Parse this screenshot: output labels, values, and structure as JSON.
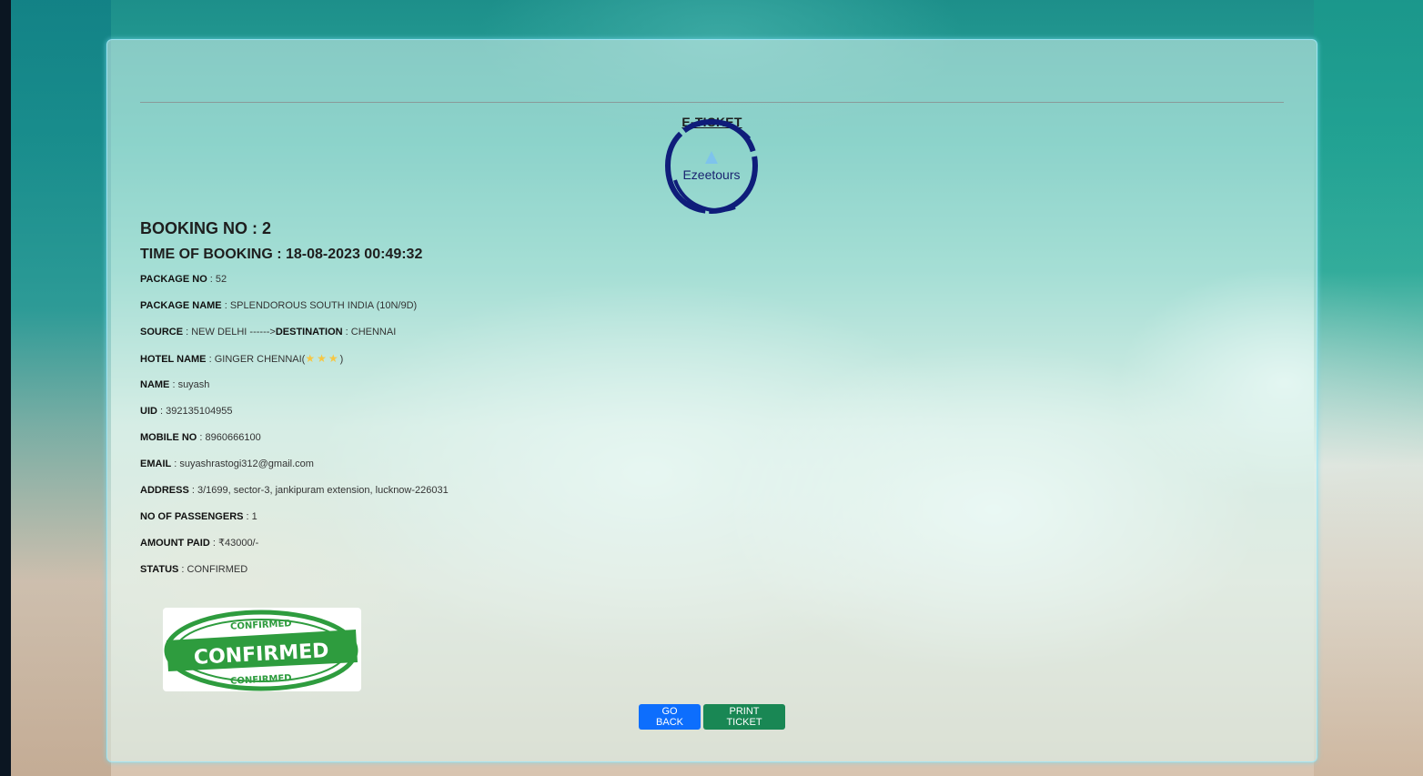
{
  "page": {
    "title": "E-TICKET"
  },
  "logo": {
    "text": "Ezeetours"
  },
  "booking": {
    "booking_no_label": "BOOKING NO :",
    "booking_no": "2",
    "time_label": "TIME OF BOOKING :",
    "time": "18-08-2023 00:49:32"
  },
  "details": {
    "package_no_label": "PACKAGE NO",
    "package_no": "52",
    "package_name_label": "PACKAGE NAME",
    "package_name": "SPLENDOROUS SOUTH INDIA (10N/9D)",
    "source_label": "SOURCE",
    "source": "NEW DELHI",
    "arrow": "------>",
    "destination_label": "DESTINATION",
    "destination": "CHENNAI",
    "hotel_label": "HOTEL NAME",
    "hotel_name": "GINGER CHENNAI",
    "hotel_stars": "★★★",
    "name_label": "NAME",
    "name": "suyash",
    "uid_label": "UID",
    "uid": "392135104955",
    "mobile_label": "MOBILE NO",
    "mobile": "8960666100",
    "email_label": "EMAIL",
    "email": "suyashrastogi312@gmail.com",
    "address_label": "ADDRESS",
    "address": "3/1699, sector-3, jankipuram extension, lucknow-226031",
    "passengers_label": "NO OF PASSENGERS",
    "passengers": "1",
    "amount_label": "AMOUNT PAID",
    "amount": "₹43000/-",
    "status_label": "STATUS",
    "status": "CONFIRMED"
  },
  "stamp": {
    "text": "CONFIRMED",
    "ring_text": "CONFIRMED"
  },
  "actions": {
    "back_label": "GO BACK",
    "print_label": "PRINT TICKET"
  },
  "colors": {
    "back_button": "#0d6efd",
    "print_button": "#198754",
    "stamp_green": "#2e9c3e",
    "logo_blue": "#0f1d7a",
    "star": "#f6c744"
  }
}
